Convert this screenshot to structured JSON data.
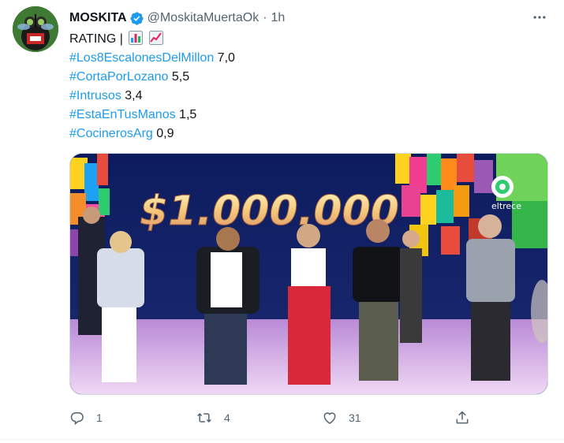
{
  "user": {
    "name": "MOSKITA",
    "handle": "@MoskitaMuertaOk",
    "separator": "·",
    "time": "1h",
    "verified": true
  },
  "tweet": {
    "intro": "RATING |",
    "intro_emojis": [
      "bar-chart-emoji",
      "chart-increasing-emoji"
    ],
    "ratings": [
      {
        "hashtag": "#Los8EscalonesDelMillon",
        "value": "7,0"
      },
      {
        "hashtag": "#CortaPorLozano",
        "value": "5,5"
      },
      {
        "hashtag": "#Intrusos",
        "value": "3,4"
      },
      {
        "hashtag": "#EstaEnTusManos",
        "value": "1,5"
      },
      {
        "hashtag": "#CocinerosArg",
        "value": "0,9"
      }
    ]
  },
  "media": {
    "overlay_text": "$1.000.000",
    "channel_logo_text": "eltrece"
  },
  "actions": {
    "reply_count": "1",
    "retweet_count": "4",
    "like_count": "31"
  },
  "colors": {
    "link": "#1d9bf0",
    "muted": "#536471",
    "text": "#0f1419",
    "verified": "#1d9bf0"
  }
}
